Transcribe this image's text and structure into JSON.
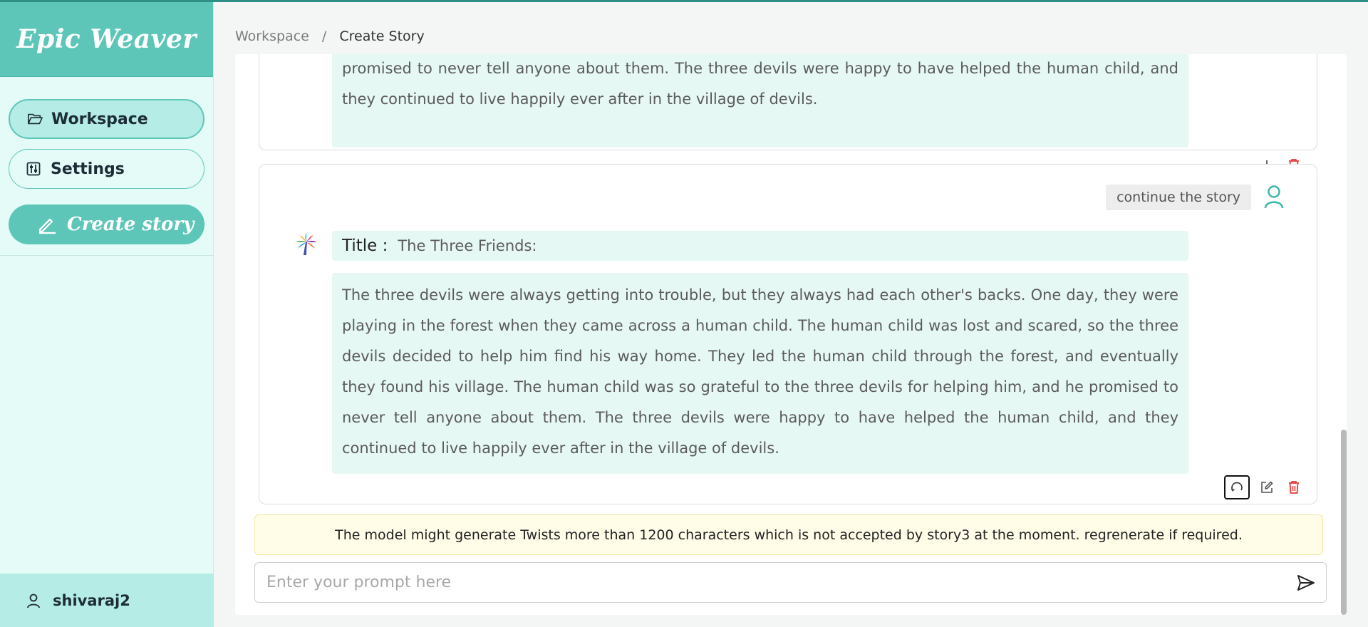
{
  "app": {
    "brand": "Epic Weaver"
  },
  "sidebar": {
    "items": [
      {
        "label": "Workspace",
        "icon": "folder-open-icon"
      },
      {
        "label": "Settings",
        "icon": "sliders-icon"
      }
    ],
    "create_label": "Create story",
    "user": "shivaraj2"
  },
  "breadcrumb": {
    "root": "Workspace",
    "separator": "/",
    "current": "Create Story"
  },
  "chat": {
    "prev_story_tail": "promised to never tell anyone about them. The three devils were happy to have helped the human child, and they continued to live happily ever after in the village of devils.",
    "user_prompt": "continue the story",
    "title_label": "Title :",
    "title_value": "The Three Friends:",
    "story": "The three devils were always getting into trouble, but they always had each other's backs. One day, they were playing in the forest when they came across a human child. The human child was lost and scared, so the three devils decided to help him find his way home. They led the human child through the forest, and eventually they found his village. The human child was so grateful to the three devils for helping him, and he promised to never tell anyone about them. The three devils were happy to have helped the human child, and they continued to live happily ever after in the village of devils."
  },
  "warning": "The model might generate Twists more than 1200 characters which is not accepted by story3 at the moment. regrenerate if required.",
  "input": {
    "placeholder": "Enter your prompt here",
    "value": ""
  },
  "colors": {
    "accent": "#5ec6b8",
    "accent_light": "#b5ece5",
    "story_bg": "#e6f8f4",
    "danger": "#e53935"
  }
}
